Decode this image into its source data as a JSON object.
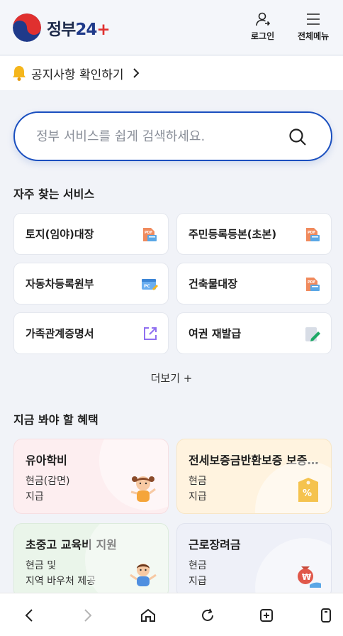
{
  "header": {
    "logo_text": "정부",
    "logo_num": "24",
    "login_label": "로그인",
    "menu_label": "전체메뉴"
  },
  "notice": {
    "text": "공지사항 확인하기"
  },
  "search": {
    "placeholder": "정부 서비스를 쉽게 검색하세요."
  },
  "frequent": {
    "title": "자주 찾는 서비스",
    "items": [
      {
        "label": "토지(임야)대장",
        "icon": "pdf-doc-icon"
      },
      {
        "label": "주민등록등본(초본)",
        "icon": "pdf-doc-icon"
      },
      {
        "label": "자동차등록원부",
        "icon": "pc-window-icon"
      },
      {
        "label": "건축물대장",
        "icon": "pdf-doc-icon"
      },
      {
        "label": "가족관계증명서",
        "icon": "external-link-icon"
      },
      {
        "label": "여권 재발급",
        "icon": "edit-doc-icon"
      }
    ],
    "more_label": "더보기 +"
  },
  "benefits": {
    "title": "지금 봐야 할 혜택",
    "cards": [
      {
        "title": "유아학비",
        "line1": "현금(감면)",
        "line2": "지급",
        "bg": "#fdeef0",
        "icon": "child-icon"
      },
      {
        "title": "전세보증금반환보증 보증료 지원",
        "line1": "현금",
        "line2": "지급",
        "bg": "#fff3df",
        "icon": "price-tag-icon"
      },
      {
        "title": "초중고 교육비 지원",
        "line1": "현금 및",
        "line2": "지역 바우처 제공",
        "bg": "#eaf5ea",
        "icon": "student-icon"
      },
      {
        "title": "근로장려금",
        "line1": "현금",
        "line2": "지급",
        "bg": "#eef0f8",
        "icon": "money-bag-icon"
      }
    ]
  },
  "bottom_nav": [
    "back-icon",
    "forward-icon",
    "home-icon",
    "reload-icon",
    "new-tab-icon",
    "tabs-icon"
  ]
}
